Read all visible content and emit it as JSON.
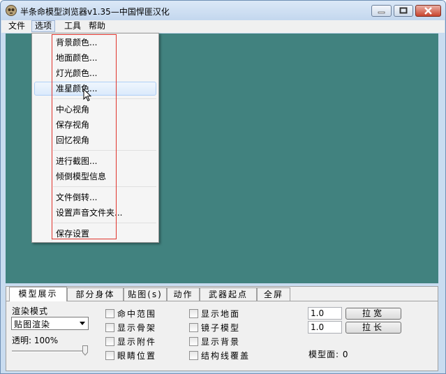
{
  "window": {
    "title": "半条命模型浏览器v1.35—中国悍匪汉化",
    "icons": {
      "app": "half-life-face-icon",
      "minimize": "minimize-icon",
      "maximize": "maximize-icon",
      "close": "close-icon"
    }
  },
  "menubar": {
    "items": [
      {
        "label": "文件"
      },
      {
        "label": "选项",
        "open": true
      },
      {
        "label": "工具"
      },
      {
        "label": "帮助"
      }
    ]
  },
  "viewport": {
    "background": "#41827f"
  },
  "dropdown": {
    "items": [
      {
        "label": "背景颜色..."
      },
      {
        "label": "地面颜色..."
      },
      {
        "label": "灯光颜色..."
      },
      {
        "label": "准星颜色...",
        "highlighted": true
      },
      {
        "label": "中心视角"
      },
      {
        "label": "保存视角"
      },
      {
        "label": "回忆视角"
      },
      {
        "label": "进行截图..."
      },
      {
        "label": "倾倒模型信息"
      },
      {
        "label": "文件倒转..."
      },
      {
        "label": "设置声音文件夹..."
      },
      {
        "label": "保存设置"
      }
    ],
    "annotation_color": "#e0342c"
  },
  "panel": {
    "tabs": [
      {
        "label": "模型展示",
        "active": true
      },
      {
        "label": "部分身体"
      },
      {
        "label": "贴图(s)"
      },
      {
        "label": "动作"
      },
      {
        "label": "武器起点"
      },
      {
        "label": "全屏"
      }
    ],
    "render_mode": {
      "label": "渲染模式",
      "value": "贴图渲染"
    },
    "transparency": {
      "label": "透明: 100%",
      "value_percent": 100
    },
    "checkboxes": [
      {
        "label": "命中范围",
        "checked": false
      },
      {
        "label": "显示骨架",
        "checked": false
      },
      {
        "label": "显示附件",
        "checked": false
      },
      {
        "label": "眼睛位置",
        "checked": false
      },
      {
        "label": "显示地面",
        "checked": false
      },
      {
        "label": "镜子模型",
        "checked": false
      },
      {
        "label": "显示背景",
        "checked": false
      },
      {
        "label": "结构线覆盖",
        "checked": false
      }
    ],
    "scale": [
      {
        "value": "1.0",
        "button": "拉宽"
      },
      {
        "value": "1.0",
        "button": "拉长"
      }
    ],
    "model_faces": "模型面: 0"
  }
}
